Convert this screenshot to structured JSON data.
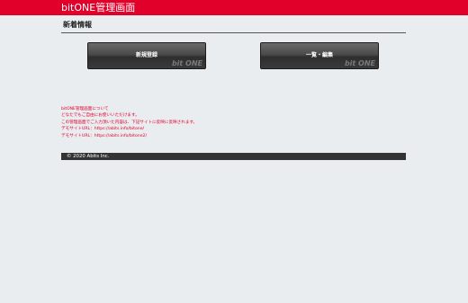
{
  "header": {
    "app_title": "bitONE管理画面"
  },
  "section": {
    "title": "新着情報"
  },
  "buttons": {
    "new": {
      "label": "新規登録",
      "watermark": "bit ONE"
    },
    "list": {
      "label": "一覧・編集",
      "watermark": "bit ONE"
    }
  },
  "notes": {
    "line1": "bitONE管理画面について",
    "line2": "どなたでもご自由にお使いいただけます。",
    "line3": "この管理画面でご入力頂いた内容は、下記サイトに反映に反映されます。",
    "line4_label": "デモサイトURL：",
    "line4_url": "https://abits.info/bitone/",
    "line5_label": "デモサイトURL：",
    "line5_url": "https://abits.info/bitone2/"
  },
  "footer": {
    "copyright": "© 2020 Abits Inc."
  },
  "colors": {
    "accent": "#e0002a",
    "footer_bg": "#333333",
    "page_bg": "#e9edf0"
  }
}
